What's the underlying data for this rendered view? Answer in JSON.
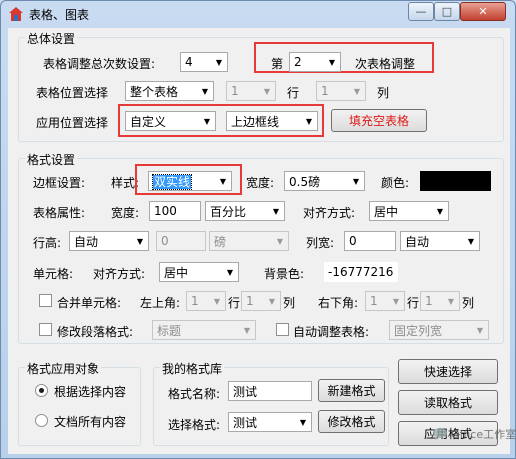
{
  "window": {
    "title": "表格、图表",
    "controls": {
      "minimize": "—",
      "maximize": "□",
      "close": "✕"
    }
  },
  "overall": {
    "group_label": "总体设置",
    "adjust_count_label": "表格调整总次数设置:",
    "adjust_count_value": "4",
    "nth_prefix": "第",
    "nth_value": "2",
    "nth_suffix": "次表格调整",
    "position_label": "表格位置选择",
    "position_value": "整个表格",
    "row_value": "1",
    "row_label": "行",
    "col_value": "1",
    "col_label": "列",
    "apply_label": "应用位置选择",
    "apply_value": "自定义",
    "border_pos_value": "上边框线",
    "fill_empty_button": "填充空表格"
  },
  "format": {
    "group_label": "格式设置",
    "border_label": "边框设置:",
    "style_label": "样式:",
    "style_value": "双实线",
    "width_label": "宽度:",
    "width_value": "0.5磅",
    "color_label": "颜色:",
    "color_value": "#000000",
    "table_prop_label": "表格属性:",
    "table_width_label": "宽度:",
    "table_width_value": "100",
    "table_width_unit": "百分比",
    "align_label": "对齐方式:",
    "align_value": "居中",
    "row_height_label": "行高:",
    "row_height_mode": "自动",
    "row_height_value": "0",
    "row_height_unit": "磅",
    "col_width_label": "列宽:",
    "col_width_value": "0",
    "col_width_mode": "自动",
    "cell_label": "单元格:",
    "cell_align_label": "对齐方式:",
    "cell_align_value": "居中",
    "bg_color_label": "背景色:",
    "bg_color_value": "-16777216",
    "merge_label": "合并单元格:",
    "top_left_label": "左上角:",
    "tl_row": "1",
    "tl_row_label": "行",
    "tl_col": "1",
    "tl_col_label": "列",
    "bottom_right_label": "右下角:",
    "br_row": "1",
    "br_row_label": "行",
    "br_col": "1",
    "br_col_label": "列",
    "para_label": "修改段落格式:",
    "para_value": "标题",
    "auto_adjust_label": "自动调整表格:",
    "auto_adjust_value": "固定列宽"
  },
  "target": {
    "group_label": "格式应用对象",
    "opt_selection": "根据选择内容",
    "opt_all": "文档所有内容"
  },
  "library": {
    "group_label": "我的格式库",
    "name_label": "格式名称:",
    "name_value": "测试",
    "new_button": "新建格式",
    "select_label": "选择格式:",
    "select_value": "测试",
    "modify_button": "修改格式"
  },
  "side": {
    "quick_select": "快速选择",
    "read_format": "读取格式",
    "apply_format": "应用格式"
  },
  "watermark": "Office工作室",
  "colors": {
    "highlight_border": "#e8393a",
    "selection": "#3399ff",
    "link_red": "#e01a1a"
  }
}
